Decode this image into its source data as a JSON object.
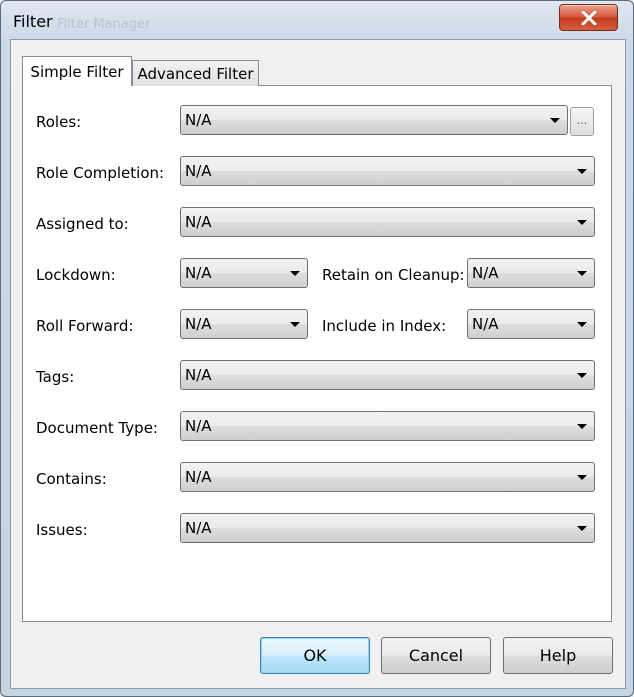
{
  "window": {
    "title": "Filter",
    "background_title": "Filter Manager"
  },
  "tabs": [
    {
      "label": "Simple Filter",
      "active": true
    },
    {
      "label": "Advanced Filter",
      "active": false
    }
  ],
  "fields": {
    "roles": {
      "label": "Roles:",
      "value": "N/A",
      "browse_label": "..."
    },
    "role_completion": {
      "label": "Role Completion:",
      "value": "N/A"
    },
    "assigned_to": {
      "label": "Assigned to:",
      "value": "N/A"
    },
    "lockdown": {
      "label": "Lockdown:",
      "value": "N/A"
    },
    "retain_on_cleanup": {
      "label": "Retain on Cleanup:",
      "value": "N/A"
    },
    "roll_forward": {
      "label": "Roll Forward:",
      "value": "N/A"
    },
    "include_in_index": {
      "label": "Include in Index:",
      "value": "N/A"
    },
    "tags": {
      "label": "Tags:",
      "value": "N/A"
    },
    "document_type": {
      "label": "Document Type:",
      "value": "N/A"
    },
    "contains": {
      "label": "Contains:",
      "value": "N/A"
    },
    "issues": {
      "label": "Issues:",
      "value": "N/A"
    }
  },
  "buttons": {
    "ok": "OK",
    "cancel": "Cancel",
    "help": "Help"
  },
  "colors": {
    "close_button": "#c23a1d",
    "default_button_border": "#3c7fb1"
  }
}
